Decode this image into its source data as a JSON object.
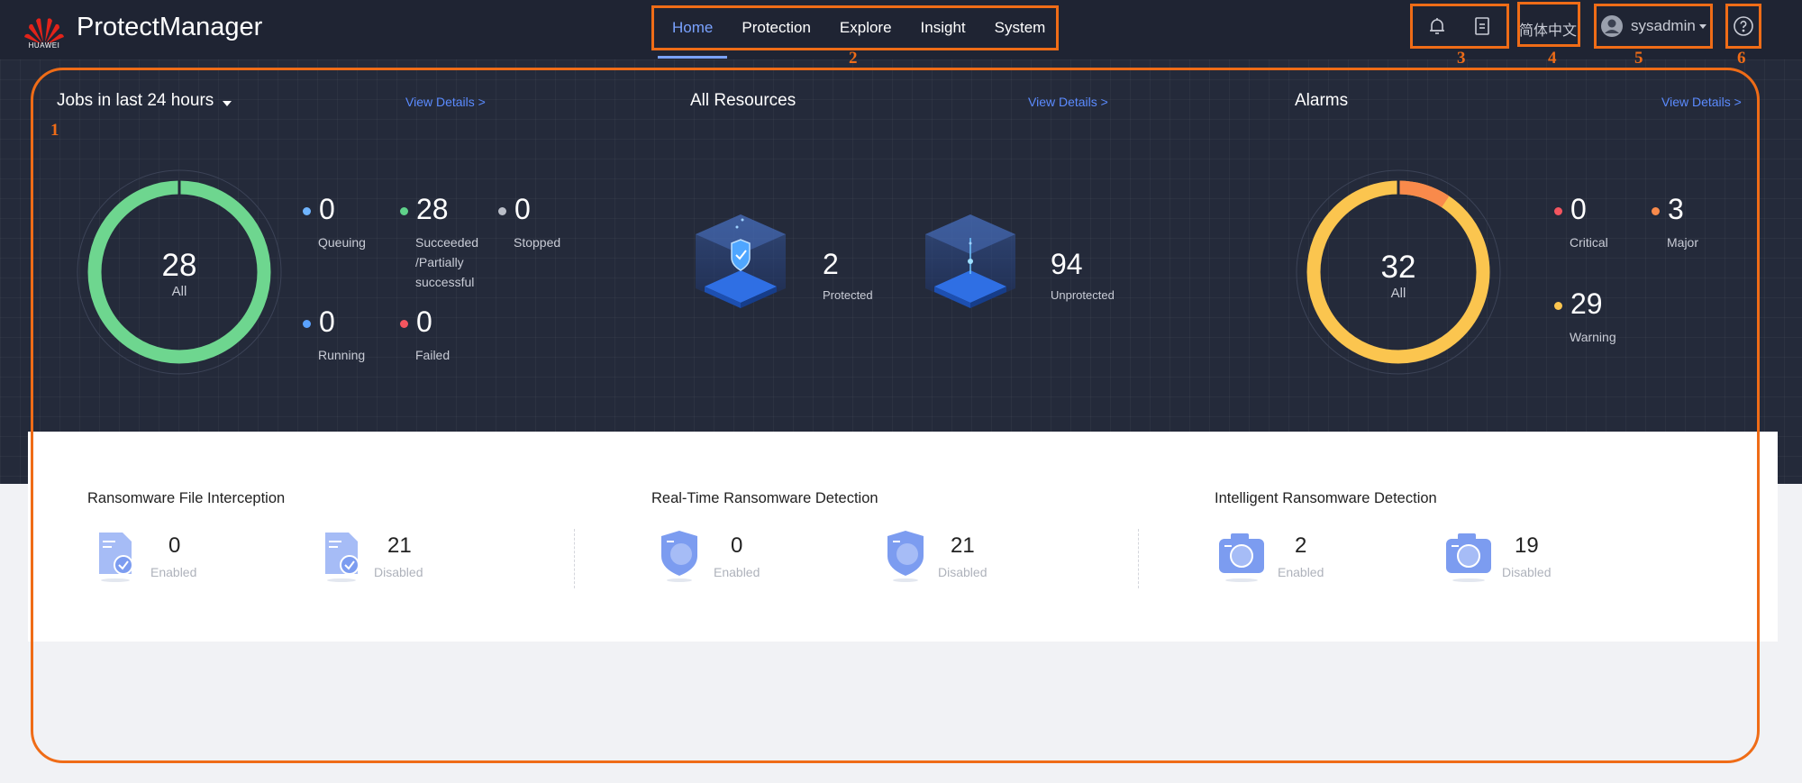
{
  "header": {
    "brand": "HUAWEI",
    "app_title": "ProtectManager",
    "nav": [
      {
        "label": "Home",
        "active": true
      },
      {
        "label": "Protection",
        "active": false
      },
      {
        "label": "Explore",
        "active": false
      },
      {
        "label": "Insight",
        "active": false
      },
      {
        "label": "System",
        "active": false
      }
    ],
    "language": "简体中文",
    "user": "sysadmin",
    "icons": [
      "bell-icon",
      "document-icon",
      "user-avatar-icon",
      "caret-down-icon",
      "help-icon"
    ]
  },
  "annotations": [
    "1",
    "2",
    "3",
    "4",
    "5",
    "6"
  ],
  "jobs": {
    "title": "Jobs in last 24 hours",
    "view_details": "View Details >",
    "total": "28",
    "total_label": "All",
    "stats": [
      {
        "value": "0",
        "label": "Queuing",
        "color": "#6fb4ff"
      },
      {
        "value": "28",
        "label": "Succeeded\n/Partially\nsuccessful",
        "color": "#5fd28a"
      },
      {
        "value": "0",
        "label": "Stopped",
        "color": "#b9bdc7"
      },
      {
        "value": "0",
        "label": "Running",
        "color": "#5aa2ff"
      },
      {
        "value": "0",
        "label": "Failed",
        "color": "#f4555f"
      }
    ]
  },
  "resources": {
    "title": "All Resources",
    "view_details": "View Details >",
    "protected": {
      "value": "2",
      "label": "Protected"
    },
    "unprotected": {
      "value": "94",
      "label": "Unprotected"
    }
  },
  "alarms": {
    "title": "Alarms",
    "view_details": "View Details >",
    "total": "32",
    "total_label": "All",
    "stats": [
      {
        "value": "0",
        "label": "Critical",
        "color": "#f4555f"
      },
      {
        "value": "3",
        "label": "Major",
        "color": "#f98a4b"
      },
      {
        "value": "29",
        "label": "Warning",
        "color": "#fbc54f"
      }
    ]
  },
  "ransomware": [
    {
      "title": "Ransomware File Interception",
      "enabled": "0",
      "disabled": "21",
      "enabled_label": "Enabled",
      "disabled_label": "Disabled",
      "icon": "file-check-icon"
    },
    {
      "title": "Real-Time Ransomware Detection",
      "enabled": "0",
      "disabled": "21",
      "enabled_label": "Enabled",
      "disabled_label": "Disabled",
      "icon": "shield-icon"
    },
    {
      "title": "Intelligent Ransomware Detection",
      "enabled": "2",
      "disabled": "19",
      "enabled_label": "Enabled",
      "disabled_label": "Disabled",
      "icon": "camera-icon"
    }
  ],
  "chart_data": [
    {
      "type": "pie",
      "title": "Jobs in last 24 hours",
      "total": 28,
      "categories": [
        "Queuing",
        "Succeeded/Partially successful",
        "Stopped",
        "Running",
        "Failed"
      ],
      "values": [
        0,
        28,
        0,
        0,
        0
      ]
    },
    {
      "type": "pie",
      "title": "Alarms",
      "total": 32,
      "categories": [
        "Critical",
        "Major",
        "Warning"
      ],
      "values": [
        0,
        3,
        29
      ]
    }
  ]
}
